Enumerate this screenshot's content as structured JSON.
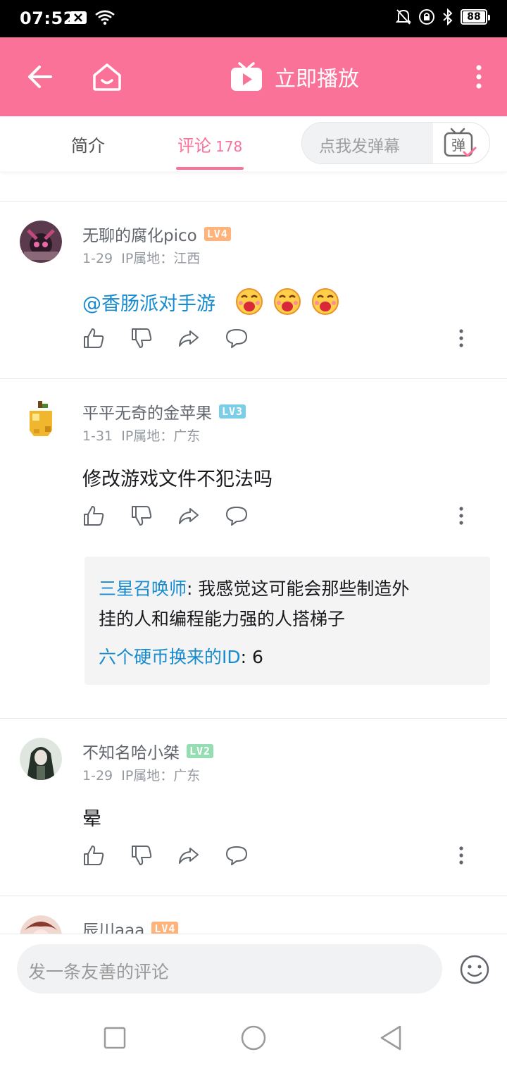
{
  "status": {
    "time": "07:52",
    "battery": "88"
  },
  "header": {
    "title": "立即播放"
  },
  "tabs": {
    "intro": "简介",
    "comments": "评论",
    "comments_count": "178",
    "danmaku_placeholder": "点我发弹幕",
    "danmaku_button": "弹"
  },
  "comments": [
    {
      "user": "无聊的腐化pico",
      "level": "LV4",
      "date": "1-29",
      "ip": "IP属地：江西",
      "mention": "@香肠派对手游",
      "text": ""
    },
    {
      "user": "平平无奇的金苹果",
      "level": "LV3",
      "date": "1-31",
      "ip": "IP属地：广东",
      "text": "修改游戏文件不犯法吗",
      "replies": [
        {
          "user": "三星召唤师",
          "text_line1": ": 我感觉这可能会那些制造外",
          "text_line2": "挂的人和编程能力强的人搭梯子"
        },
        {
          "user": "六个硬币换来的ID",
          "text": ": 6"
        }
      ]
    },
    {
      "user": "不知名哈小桀",
      "level": "LV2",
      "date": "1-29",
      "ip": "IP属地：广东",
      "text": "晕"
    },
    {
      "user": "辰川aaa",
      "level": "LV4"
    }
  ],
  "composer": {
    "placeholder": "发一条友善的评论"
  },
  "colors": {
    "brand": "#fb7299",
    "link": "#178bcf"
  }
}
